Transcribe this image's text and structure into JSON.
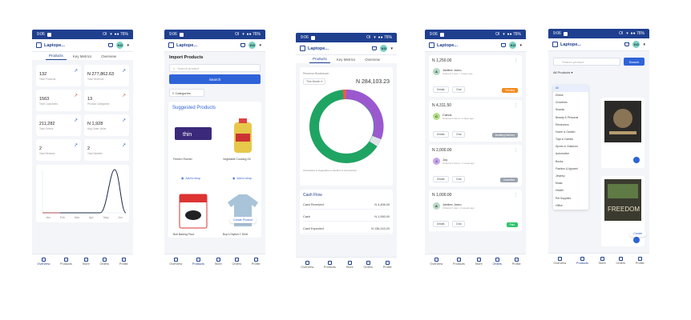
{
  "status": {
    "carrier": "9:06",
    "right": "Ol   ▾  ●● 76%"
  },
  "app": {
    "brand": "Laptope...",
    "avatar": "KO"
  },
  "nav": {
    "items": [
      "Overview",
      "Products",
      "Store",
      "Orders",
      "Profile"
    ]
  },
  "phone1": {
    "tabs": [
      "Products",
      "Key Metrics",
      "Overview"
    ],
    "stats": [
      {
        "value": "132",
        "label": "Total Products",
        "trend": "up",
        "color": "#2e63d8"
      },
      {
        "value": "N 277,862.63",
        "label": "Total Revenue",
        "trend": "up",
        "color": "#2e63d8"
      },
      {
        "value": "1563",
        "label": "Total Customers",
        "trend": "up",
        "color": "#d9534f"
      },
      {
        "value": "13",
        "label": "Product Categories",
        "trend": "up",
        "color": "#d9534f"
      },
      {
        "value": "211,282",
        "label": "Total Orders",
        "trend": "up",
        "color": "#2e63d8"
      },
      {
        "value": "N 1,928",
        "label": "Avg Order Value",
        "trend": "up",
        "color": "#2e63d8"
      },
      {
        "value": "2",
        "label": "Total Reviews",
        "trend": "up",
        "color": "#2e63d8"
      },
      {
        "value": "2",
        "label": "Total Wishlist",
        "trend": "up",
        "color": "#2e63d8"
      }
    ],
    "chart_labels": [
      "Jan",
      "Feb",
      "Mar",
      "Apr",
      "May",
      "Jun"
    ]
  },
  "phone2": {
    "heading": "Import Products",
    "search_placeholder": "Search product",
    "search_button": "Search",
    "category_chip": "Categories",
    "suggested_title": "Suggested Products",
    "products": [
      {
        "caption": "Ferrero Rocher",
        "bg": "#f2f3f7"
      },
      {
        "caption": "Vegetable Cooking Oil",
        "bg": "#f6e7a3"
      },
      {
        "caption": "Bull Baking Flour",
        "bg": "#fbeaea"
      },
      {
        "caption": "Boy's Stylish T-Shirt",
        "bg": "#d9e5ee"
      }
    ],
    "shop_labels": [
      "Add to shop",
      "Add to shop"
    ],
    "floating_btn": "Create Product"
  },
  "phone3": {
    "tabs": [
      "Products",
      "Key Metrics",
      "Overview"
    ],
    "revenue_title": "Revenue Breakdown",
    "period": "This Month",
    "revenue_total": "N 284,103.23",
    "legend": "Chocolates ● Vegetables ● Fashion ● Accessories",
    "cash_title": "Cash Flow",
    "cash_rows": [
      {
        "label": "Cash Received",
        "value": "N 4,456.00"
      },
      {
        "label": "Cash",
        "value": "N 1,950.00"
      },
      {
        "label": "Cash Expected",
        "value": "N 136,243.20"
      }
    ]
  },
  "phone4": {
    "orders": [
      {
        "amount": "N 1,250.00",
        "initial": "A",
        "avatar_bg": "#b7d9c5",
        "name": "Jubilee Jumo",
        "sub": "Ordered 1 item • 2 days ago",
        "status": "Pending",
        "status_color": "#f28a1d"
      },
      {
        "amount": "N 4,311.50",
        "initial": "C",
        "avatar_bg": "#b4e08b",
        "name": "Carlos",
        "sub": "Ordered 3 items • 5 days ago",
        "status": "Awaiting Delivery",
        "status_color": "#9aa3ae"
      },
      {
        "amount": "N 2,000.00",
        "initial": "J",
        "avatar_bg": "#c9a6ef",
        "name": "Joy",
        "sub": "Ordered 2 items • 1 week ago",
        "status": "Cancelled",
        "status_color": "#9aa3ae"
      },
      {
        "amount": "N 1,000.00",
        "initial": "A",
        "avatar_bg": "#b7d9c5",
        "name": "Jubilee Jumo",
        "sub": "Ordered 1 item • 2 weeks ago",
        "status": "Paid",
        "status_color": "#2ec46a"
      }
    ],
    "buttons": [
      "Details",
      "Chat"
    ]
  },
  "phone5": {
    "search_placeholder": "Search product",
    "search_button": "Search",
    "filter": "All Products",
    "categories": [
      "All",
      "Drinks",
      "Groceries",
      "Snacks",
      "Beauty & Personal",
      "Electronics",
      "Home & Garden",
      "Toys & Games",
      "Sports & Outdoors",
      "Automotive",
      "Books",
      "Fashion & Apparel",
      "Jewelry",
      "Music",
      "Health",
      "Pet Supplies",
      "Office"
    ],
    "fab": "Create"
  }
}
